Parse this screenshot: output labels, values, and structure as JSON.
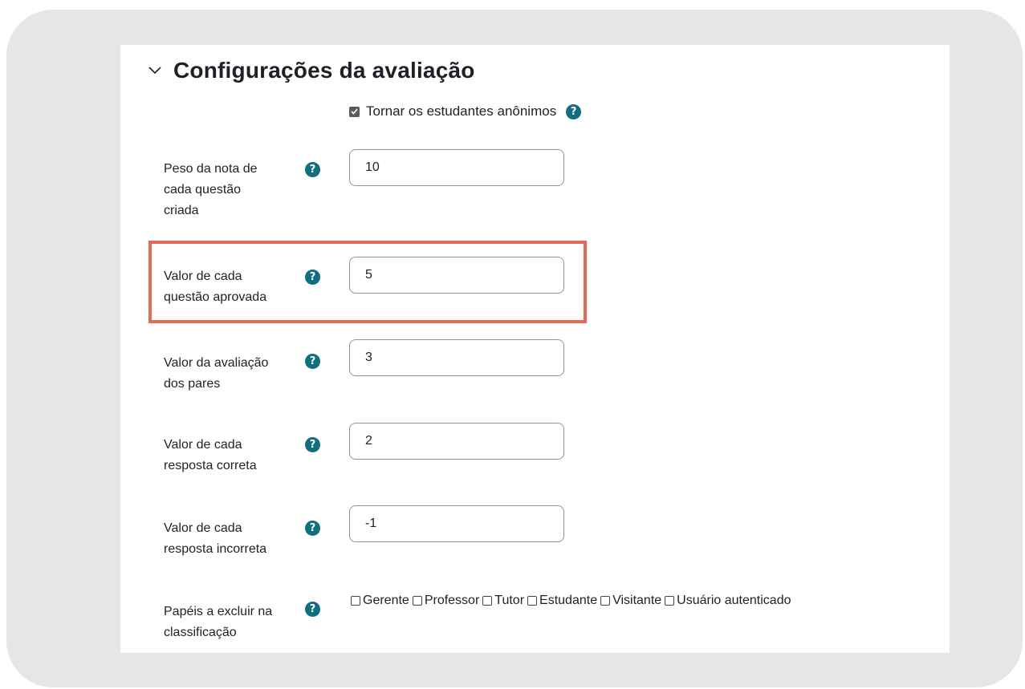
{
  "section": {
    "title": "Configurações da avaliação",
    "chevron_icon": "chevron-down-icon"
  },
  "anonymous": {
    "label": "Tornar os estudantes anônimos",
    "checked": true
  },
  "help_icon": {
    "glyph": "?",
    "color": "#0f6e80"
  },
  "highlight_color": "#e46a55",
  "fields": [
    {
      "label_lines": [
        "Peso da nota de",
        "cada questão",
        "criada"
      ],
      "value": "10"
    },
    {
      "label_lines": [
        "Valor de cada",
        "questão aprovada"
      ],
      "value": "5"
    },
    {
      "label_lines": [
        "Valor da avaliação",
        "dos pares"
      ],
      "value": "3"
    },
    {
      "label_lines": [
        "Valor de cada",
        "resposta correta"
      ],
      "value": "2"
    },
    {
      "label_lines": [
        "Valor de cada",
        "resposta incorreta"
      ],
      "value": "-1"
    }
  ],
  "roles": {
    "label_lines": [
      "Papéis a excluir na",
      "classificação"
    ],
    "options": [
      {
        "label": "Gerente",
        "checked": false
      },
      {
        "label": "Professor",
        "checked": false
      },
      {
        "label": "Tutor",
        "checked": false
      },
      {
        "label": "Estudante",
        "checked": false
      },
      {
        "label": "Visitante",
        "checked": false
      },
      {
        "label": "Usuário autenticado",
        "checked": false
      }
    ]
  }
}
